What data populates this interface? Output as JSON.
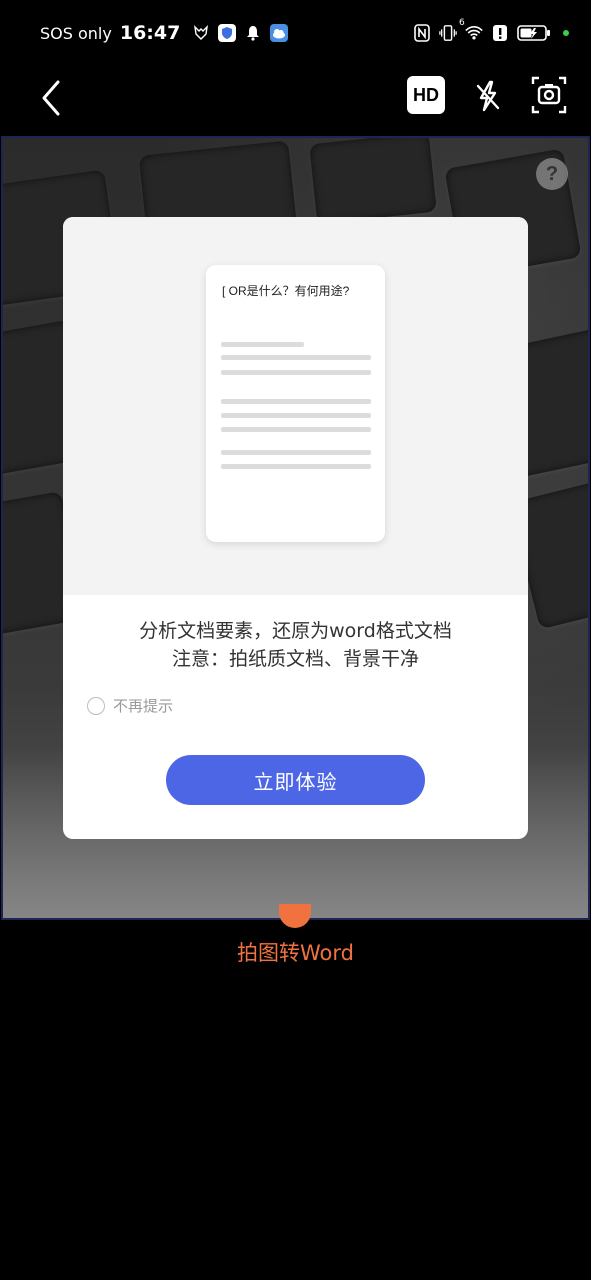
{
  "status_bar": {
    "carrier": "SOS only",
    "time": "16:47",
    "icons": [
      "fox-icon",
      "shield-icon",
      "bell-icon",
      "weather-icon",
      "nfc-icon",
      "vibrate-icon",
      "wifi-icon",
      "alert-icon",
      "battery-charging-icon"
    ],
    "wifi_badge": "6"
  },
  "top_bar": {
    "hd_label": "HD",
    "icons": [
      "back-icon",
      "flash-off-icon",
      "camera-switch-icon"
    ]
  },
  "help": {
    "label": "?"
  },
  "dialog": {
    "doc_title": "[  OR是什么？有何用途?",
    "line1": "分析文档要素，还原为word格式文档",
    "line2": "注意：拍纸质文档、背景干净",
    "checkbox_label": "不再提示",
    "button_label": "立即体验"
  },
  "mode_label": "拍图转Word",
  "colors": {
    "accent": "#4d66e5",
    "mode": "#f0733f",
    "preview_border": "#1b2750"
  }
}
